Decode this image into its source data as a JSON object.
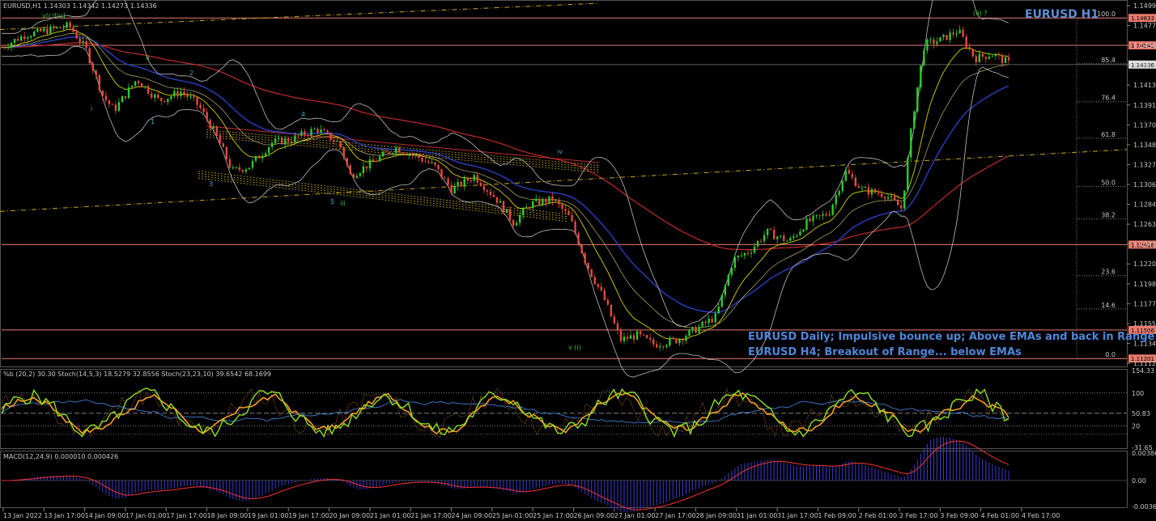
{
  "chart_data": {
    "type": "candlestick",
    "symbol_header": "EURUSD,H1  1.14303 1.14342 1.14273 1.14336",
    "title": "EURUSD H1",
    "wave_top_label": "v(c)[iv]",
    "annotations": [
      "EURUSD Daily; Impulsive bounce up; Above EMAs and back in Range",
      "EURUSD H4; Breakout of Range... below EMAs"
    ],
    "y_ticks": [
      "1.14990",
      "1.14775",
      "1.14560",
      "1.14345",
      "1.14130",
      "1.13915",
      "1.13700",
      "1.13485",
      "1.13270",
      "1.13060",
      "1.12845",
      "1.12630",
      "1.12415",
      "1.12200",
      "1.11985",
      "1.11770",
      "1.11556",
      "1.11340",
      "1.11125"
    ],
    "ylim": [
      1.11125,
      1.1499
    ],
    "price_levels": [
      {
        "value": 1.14833,
        "label": "1.14833"
      },
      {
        "value": 1.14541,
        "label": "1.14541"
      },
      {
        "value": 1.12416,
        "label": "1.12416"
      },
      {
        "value": 1.11506,
        "label": "1.11506"
      },
      {
        "value": 1.11201,
        "label": "1.11201"
      }
    ],
    "current_price": {
      "value": 1.14336,
      "label": "1.14336"
    },
    "fib_levels": [
      {
        "value": 1.14833,
        "label": "100.0"
      },
      {
        "value": 1.14345,
        "label": "85.4"
      },
      {
        "value": 1.1394,
        "label": "76.4"
      },
      {
        "value": 1.1355,
        "label": "61.8"
      },
      {
        "value": 1.13035,
        "label": "50.0"
      },
      {
        "value": 1.1269,
        "label": "38.2"
      },
      {
        "value": 1.12085,
        "label": "23.6"
      },
      {
        "value": 1.1173,
        "label": "14.6"
      },
      {
        "value": 1.11201,
        "label": "0.0"
      }
    ],
    "x_ticks": [
      "13 Jan 2022",
      "13 Jan 17:00",
      "14 Jan 09:00",
      "17 Jan 01:00",
      "17 Jan 17:00",
      "18 Jan 09:00",
      "19 Jan 01:00",
      "19 Jan 17:00",
      "20 Jan 09:00",
      "21 Jan 01:00",
      "21 Jan 17:00",
      "24 Jan 09:00",
      "25 Jan 01:00",
      "25 Jan 17:00",
      "26 Jan 09:00",
      "27 Jan 01:00",
      "27 Jan 17:00",
      "28 Jan 09:00",
      "31 Jan 01:00",
      "31 Jan 17:00",
      "1 Feb 09:00",
      "2 Feb 01:00",
      "2 Feb 17:00",
      "3 Feb 09:00",
      "4 Feb 01:00",
      "4 Feb 17:00"
    ],
    "close_path": [
      [
        0,
        1.1452
      ],
      [
        0.02,
        1.1465
      ],
      [
        0.04,
        1.147
      ],
      [
        0.06,
        1.1475
      ],
      [
        0.075,
        1.145
      ],
      [
        0.09,
        1.14
      ],
      [
        0.1,
        1.1385
      ],
      [
        0.12,
        1.1418
      ],
      [
        0.14,
        1.1395
      ],
      [
        0.16,
        1.1405
      ],
      [
        0.175,
        1.139
      ],
      [
        0.19,
        1.136
      ],
      [
        0.205,
        1.132
      ],
      [
        0.22,
        1.1325
      ],
      [
        0.24,
        1.135
      ],
      [
        0.26,
        1.1355
      ],
      [
        0.28,
        1.1365
      ],
      [
        0.3,
        1.135
      ],
      [
        0.31,
        1.1315
      ],
      [
        0.33,
        1.133
      ],
      [
        0.35,
        1.1345
      ],
      [
        0.37,
        1.1335
      ],
      [
        0.385,
        1.1325
      ],
      [
        0.4,
        1.13
      ],
      [
        0.42,
        1.1315
      ],
      [
        0.44,
        1.129
      ],
      [
        0.455,
        1.1265
      ],
      [
        0.47,
        1.1285
      ],
      [
        0.49,
        1.129
      ],
      [
        0.505,
        1.127
      ],
      [
        0.52,
        1.122
      ],
      [
        0.535,
        1.1185
      ],
      [
        0.55,
        1.114
      ],
      [
        0.565,
        1.1145
      ],
      [
        0.58,
        1.1135
      ],
      [
        0.6,
        1.114
      ],
      [
        0.615,
        1.115
      ],
      [
        0.635,
        1.1165
      ],
      [
        0.65,
        1.1225
      ],
      [
        0.665,
        1.1235
      ],
      [
        0.68,
        1.1255
      ],
      [
        0.7,
        1.1245
      ],
      [
        0.715,
        1.1265
      ],
      [
        0.735,
        1.1275
      ],
      [
        0.75,
        1.132
      ],
      [
        0.765,
        1.13
      ],
      [
        0.785,
        1.1295
      ],
      [
        0.8,
        1.128
      ],
      [
        0.81,
        1.138
      ],
      [
        0.82,
        1.1455
      ],
      [
        0.835,
        1.146
      ],
      [
        0.85,
        1.147
      ],
      [
        0.865,
        1.144
      ],
      [
        0.88,
        1.1445
      ],
      [
        0.895,
        1.1435
      ]
    ],
    "osc_levels": [
      "154.33",
      "100",
      "50.83",
      "20",
      "-31.65"
    ],
    "osc_header": "%b (20,2) 30.30  Stoch(14,5,3) 18.5279 32.8556  Stoch(23,23,10) 39.6542 68.1699",
    "macd_header": "MACD(12,24,9) 0.000010 0.000426",
    "macd_levels": [
      "0.003867",
      "0.00",
      "-0.003651"
    ],
    "elliott_labels": [
      "i",
      "ii",
      "1",
      "2",
      "3",
      "4",
      "5",
      "iii",
      "iv",
      "v (i)",
      "(ii) ?"
    ],
    "colors": {
      "background": "#000000",
      "bull": "#2ecc2e",
      "bear": "#e64b3c",
      "level_line": "#e87a6e",
      "ema_blue": "#2b3fbf",
      "ema_red": "#c42b2b",
      "ema_yellow": "#d8d000",
      "bollinger": "#bdbdbd",
      "trend": "#c9a71a",
      "osc_green": "#8fe01e",
      "osc_orange": "#f49b22",
      "osc_blue": "#3e7fcf",
      "macd": "#3b3bd6",
      "macd_signal": "#e0302f"
    }
  }
}
